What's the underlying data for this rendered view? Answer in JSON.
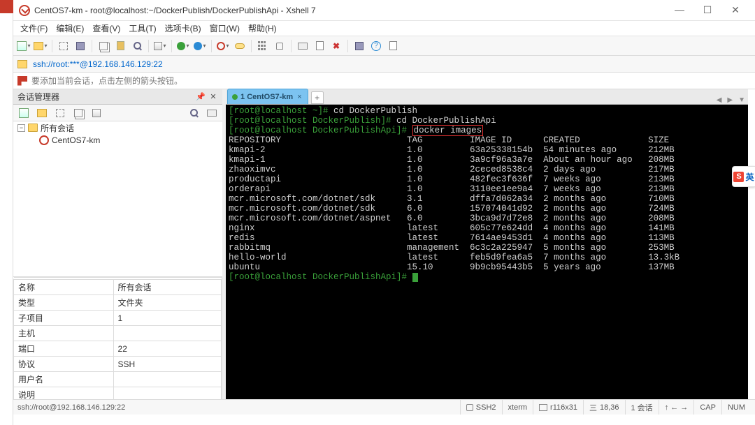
{
  "title": "CentOS7-km - root@localhost:~/DockerPublish/DockerPublishApi - Xshell 7",
  "menu": [
    "文件(F)",
    "编辑(E)",
    "查看(V)",
    "工具(T)",
    "选项卡(B)",
    "窗口(W)",
    "帮助(H)"
  ],
  "addr": "ssh://root:***@192.168.146.129:22",
  "tip": "要添加当前会话，点击左侧的箭头按钮。",
  "sessMgr": {
    "title": "会话管理器",
    "root": "所有会话",
    "child": "CentOS7-km"
  },
  "props": {
    "header": [
      "名称",
      "所有会话"
    ],
    "rows": [
      [
        "类型",
        "文件夹"
      ],
      [
        "子项目",
        "1"
      ],
      [
        "主机",
        ""
      ],
      [
        "端口",
        "22"
      ],
      [
        "协议",
        "SSH"
      ],
      [
        "用户名",
        ""
      ],
      [
        "说明",
        ""
      ]
    ]
  },
  "tab": {
    "num": "1",
    "label": "CentOS7-km",
    "plus": "+"
  },
  "terminal": {
    "lines": [
      {
        "prompt": "[root@localhost ~]#",
        "cmd": " cd DockerPublish"
      },
      {
        "prompt": "[root@localhost DockerPublish]#",
        "cmd": " cd DockerPublishApi"
      },
      {
        "prompt": "[root@localhost DockerPublishApi]#",
        "cmd": " ",
        "hl": "docker images"
      }
    ],
    "cols": [
      "REPOSITORY",
      "TAG",
      "IMAGE ID",
      "CREATED",
      "SIZE"
    ],
    "rows": [
      [
        "kmapi-2",
        "1.0",
        "63a25338154b",
        "54 minutes ago",
        "212MB"
      ],
      [
        "kmapi-1",
        "1.0",
        "3a9cf96a3a7e",
        "About an hour ago",
        "208MB"
      ],
      [
        "zhaoximvc",
        "1.0",
        "2ceced8538c4",
        "2 days ago",
        "217MB"
      ],
      [
        "productapi",
        "1.0",
        "482fec3f636f",
        "7 weeks ago",
        "213MB"
      ],
      [
        "orderapi",
        "1.0",
        "3110ee1ee9a4",
        "7 weeks ago",
        "213MB"
      ],
      [
        "mcr.microsoft.com/dotnet/sdk",
        "3.1",
        "dffa7d062a34",
        "2 months ago",
        "710MB"
      ],
      [
        "mcr.microsoft.com/dotnet/sdk",
        "6.0",
        "157074041d92",
        "2 months ago",
        "724MB"
      ],
      [
        "mcr.microsoft.com/dotnet/aspnet",
        "6.0",
        "3bca9d7d72e8",
        "2 months ago",
        "208MB"
      ],
      [
        "nginx",
        "latest",
        "605c77e624dd",
        "4 months ago",
        "141MB"
      ],
      [
        "redis",
        "latest",
        "7614ae9453d1",
        "4 months ago",
        "113MB"
      ],
      [
        "rabbitmq",
        "management",
        "6c3c2a225947",
        "5 months ago",
        "253MB"
      ],
      [
        "hello-world",
        "latest",
        "feb5d9fea6a5",
        "7 months ago",
        "13.3kB"
      ],
      [
        "ubuntu",
        "15.10",
        "9b9cb95443b5",
        "5 years ago",
        "137MB"
      ]
    ],
    "prompt_end": "[root@localhost DockerPublishApi]#"
  },
  "status": {
    "path": "ssh://root@192.168.146.129:22",
    "ssh": "SSH2",
    "term": "xterm",
    "size": "116x31",
    "pos": "18,36",
    "sess": "1 会话",
    "cap": "CAP",
    "num": "NUM"
  },
  "sogou": {
    "s": "S",
    "lang": "英"
  }
}
